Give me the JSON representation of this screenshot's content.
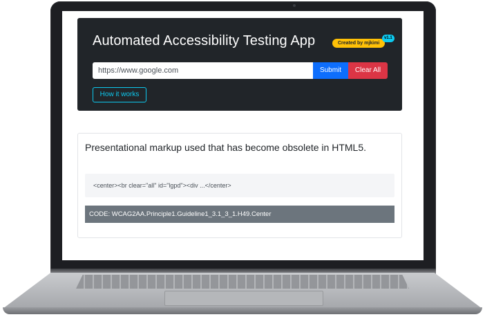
{
  "app": {
    "title": "Automated Accessibility Testing App",
    "author_badge": "Created by mjkimi",
    "version_badge": "v1.1"
  },
  "search": {
    "value": "https://www.google.com",
    "submit_label": "Submit",
    "clear_label": "Clear All"
  },
  "help": {
    "label": "How it works"
  },
  "result": {
    "message": "Presentational markup used that has become obsolete in HTML5.",
    "snippet": "<center><br clear=\"all\" id=\"lgpd\"><div ...</center>",
    "code": "CODE: WCAG2AA.Principle1.Guideline1_3.1_3_1.H49.Center"
  },
  "colors": {
    "header_bg": "#212529",
    "primary": "#0d6efd",
    "danger": "#dc3545",
    "info": "#0dcaf0",
    "warning": "#ffc107",
    "secondary": "#6c757d"
  }
}
